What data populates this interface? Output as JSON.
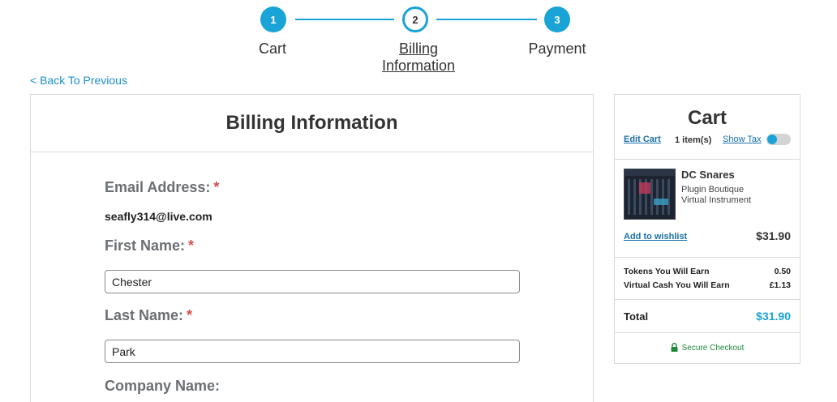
{
  "stepper": {
    "steps": [
      {
        "number": "1",
        "label": "Cart",
        "state": "completed"
      },
      {
        "number": "2",
        "label": "Billing Information",
        "state": "current"
      },
      {
        "number": "3",
        "label": "Payment",
        "state": "upcoming"
      }
    ]
  },
  "nav": {
    "back_label": "< Back To Previous"
  },
  "billing": {
    "title": "Billing Information",
    "required_marker": "*",
    "email_label": "Email Address:",
    "email_value": "seafly314@live.com",
    "first_name_label": "First Name:",
    "first_name_value": "Chester",
    "last_name_label": "Last Name:",
    "last_name_value": "Park",
    "company_label": "Company Name:"
  },
  "cart": {
    "title": "Cart",
    "edit_label": "Edit Cart",
    "item_count": "1 item(s)",
    "show_tax_label": "Show Tax",
    "show_tax_on": false,
    "product": {
      "name": "DC Snares",
      "vendor": "Plugin Boutique",
      "type": "Virtual Instrument",
      "price": "$31.90",
      "wishlist_label": "Add to wishlist"
    },
    "tokens_label": "Tokens You Will Earn",
    "tokens_value": "0.50",
    "cash_label": "Virtual Cash You Will Earn",
    "cash_value": "£1.13",
    "total_label": "Total",
    "total_value": "$31.90",
    "secure_label": "Secure Checkout"
  },
  "colors": {
    "accent": "#1aa3d6",
    "link": "#1a6fa8",
    "required": "#d64f4f",
    "secure": "#1f8a3a"
  }
}
